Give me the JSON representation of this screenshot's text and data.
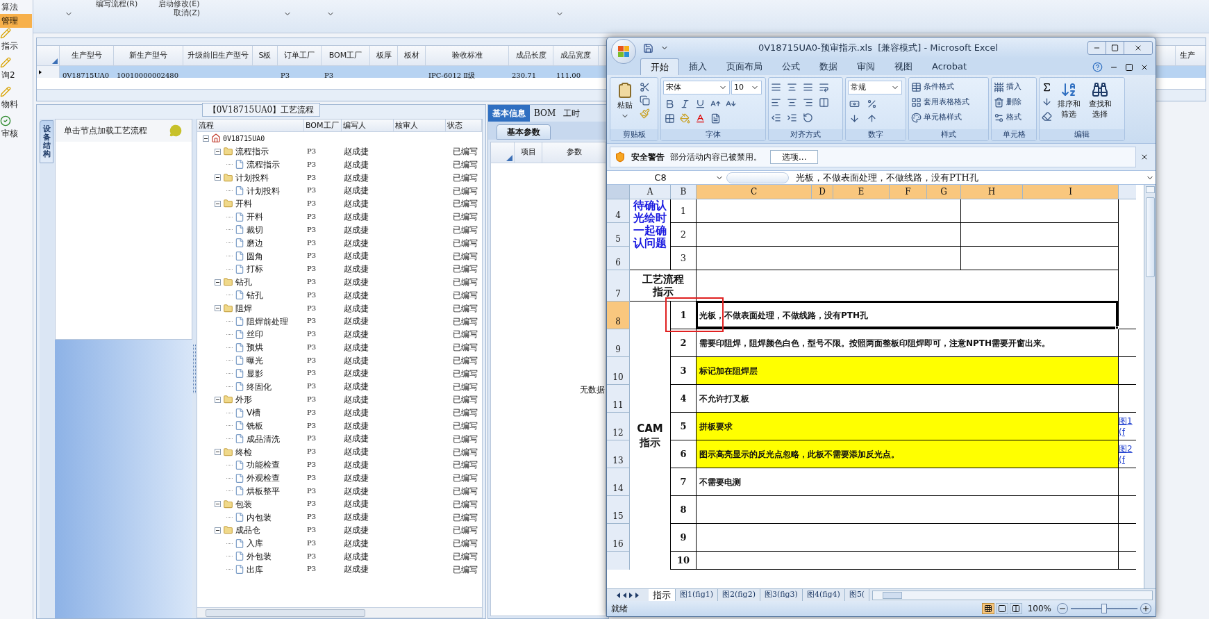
{
  "nav": [
    {
      "label": "算法",
      "selected": false,
      "kind": "text"
    },
    {
      "label": "管理",
      "selected": true,
      "kind": "text"
    },
    {
      "label": "指示",
      "selected": false,
      "kind": "pencil"
    },
    {
      "label": "询2",
      "selected": false,
      "kind": "pencil"
    },
    {
      "label": "物料",
      "selected": false,
      "kind": "pencil"
    },
    {
      "label": "审核",
      "selected": false,
      "kind": "check"
    }
  ],
  "toolbar": {
    "buttons": [
      "编写流程(R)",
      "启动修改(E)",
      "取消(Z)"
    ]
  },
  "main_grid": {
    "columns": [
      "生产型号",
      "新生产型号",
      "升级前旧生产型号",
      "S板",
      "订单工厂",
      "BOM工厂",
      "板厚",
      "板材",
      "验收标准",
      "成品长度",
      "成品宽度",
      "生产"
    ],
    "rows": [
      {
        "selected": true,
        "cells": [
          {
            "kind": "text",
            "text": "0V18715UA0"
          },
          {
            "kind": "text",
            "text": "10010000002480"
          },
          {
            "kind": "blank"
          },
          {
            "kind": "blank"
          },
          {
            "kind": "text",
            "text": "P3"
          },
          {
            "kind": "text",
            "text": "P3"
          },
          {
            "kind": "blank"
          },
          {
            "kind": "blank"
          },
          {
            "kind": "text",
            "text": "IPC-6012 Ⅱ级"
          },
          {
            "kind": "text",
            "text": "230.71"
          },
          {
            "kind": "text",
            "text": "111.00"
          }
        ]
      }
    ]
  },
  "process_panel": {
    "title": "【0V18715UA0】工艺流程",
    "side_tab": "设备结构",
    "hint": "单击节点加载工艺流程",
    "columns": [
      "流程",
      "BOM工厂",
      "编写人",
      "核审人",
      "状态"
    ],
    "tree": {
      "label": "0V18715UA0",
      "expanded": true,
      "children": [
        {
          "label": "流程指示",
          "bom": "P3",
          "writer": "赵成捷",
          "status": "已编写",
          "expanded": true,
          "children": [
            {
              "label": "流程指示",
              "bom": "P3",
              "writer": "赵成捷",
              "status": "已编写"
            }
          ]
        },
        {
          "label": "计划投料",
          "bom": "P3",
          "writer": "赵成捷",
          "status": "已编写",
          "expanded": true,
          "children": [
            {
              "label": "计划投料",
              "bom": "P3",
              "writer": "赵成捷",
              "status": "已编写"
            }
          ]
        },
        {
          "label": "开料",
          "bom": "P3",
          "writer": "赵成捷",
          "status": "已编写",
          "expanded": true,
          "children": [
            {
              "label": "开料",
              "bom": "P3",
              "writer": "赵成捷",
              "status": "已编写"
            },
            {
              "label": "裁切",
              "bom": "P3",
              "writer": "赵成捷",
              "status": "已编写"
            },
            {
              "label": "磨边",
              "bom": "P3",
              "writer": "赵成捷",
              "status": "已编写"
            },
            {
              "label": "圆角",
              "bom": "P3",
              "writer": "赵成捷",
              "status": "已编写"
            },
            {
              "label": "打标",
              "bom": "P3",
              "writer": "赵成捷",
              "status": "已编写"
            }
          ]
        },
        {
          "label": "钻孔",
          "bom": "P3",
          "writer": "赵成捷",
          "status": "已编写",
          "expanded": true,
          "children": [
            {
              "label": "钻孔",
              "bom": "P3",
              "writer": "赵成捷",
              "status": "已编写"
            }
          ]
        },
        {
          "label": "阻焊",
          "bom": "P3",
          "writer": "赵成捷",
          "status": "已编写",
          "expanded": true,
          "children": [
            {
              "label": "阻焊前处理",
              "bom": "P3",
              "writer": "赵成捷",
              "status": "已编写"
            },
            {
              "label": "丝印",
              "bom": "P3",
              "writer": "赵成捷",
              "status": "已编写"
            },
            {
              "label": "预烘",
              "bom": "P3",
              "writer": "赵成捷",
              "status": "已编写"
            },
            {
              "label": "曝光",
              "bom": "P3",
              "writer": "赵成捷",
              "status": "已编写"
            },
            {
              "label": "显影",
              "bom": "P3",
              "writer": "赵成捷",
              "status": "已编写"
            },
            {
              "label": "终固化",
              "bom": "P3",
              "writer": "赵成捷",
              "status": "已编写"
            }
          ]
        },
        {
          "label": "外形",
          "bom": "P3",
          "writer": "赵成捷",
          "status": "已编写",
          "expanded": true,
          "children": [
            {
              "label": "V槽",
              "bom": "P3",
              "writer": "赵成捷",
              "status": "已编写"
            },
            {
              "label": "铣板",
              "bom": "P3",
              "writer": "赵成捷",
              "status": "已编写"
            },
            {
              "label": "成品清洗",
              "bom": "P3",
              "writer": "赵成捷",
              "status": "已编写"
            }
          ]
        },
        {
          "label": "终检",
          "bom": "P3",
          "writer": "赵成捷",
          "status": "已编写",
          "expanded": true,
          "children": [
            {
              "label": "功能检查",
              "bom": "P3",
              "writer": "赵成捷",
              "status": "已编写"
            },
            {
              "label": "外观检查",
              "bom": "P3",
              "writer": "赵成捷",
              "status": "已编写"
            },
            {
              "label": "烘板整平",
              "bom": "P3",
              "writer": "赵成捷",
              "status": "已编写"
            }
          ]
        },
        {
          "label": "包装",
          "bom": "P3",
          "writer": "赵成捷",
          "status": "已编写",
          "expanded": true,
          "children": [
            {
              "label": "内包装",
              "bom": "P3",
              "writer": "赵成捷",
              "status": "已编写"
            }
          ]
        },
        {
          "label": "成品仓",
          "bom": "P3",
          "writer": "赵成捷",
          "status": "已编写",
          "expanded": true,
          "children": [
            {
              "label": "入库",
              "bom": "P3",
              "writer": "赵成捷",
              "status": "已编写"
            },
            {
              "label": "外包装",
              "bom": "P3",
              "writer": "赵成捷",
              "status": "已编写"
            },
            {
              "label": "出库",
              "bom": "P3",
              "writer": "赵成捷",
              "status": "已编写"
            }
          ]
        }
      ]
    }
  },
  "info_panel": {
    "tabs": [
      {
        "label": "基本信息",
        "selected": true
      },
      {
        "label": "BOM",
        "selected": false
      },
      {
        "label": "工时",
        "selected": false
      }
    ],
    "sub_tab": "基本参数",
    "columns": [
      "项目",
      "参数"
    ],
    "empty_text": "无数据"
  },
  "excel": {
    "title": "0V18715UA0-预审指示.xls  [兼容模式] - Microsoft Excel",
    "ribbon_tabs": [
      {
        "label": "开始",
        "selected": true
      },
      {
        "label": "插入",
        "selected": false
      },
      {
        "label": "页面布局",
        "selected": false
      },
      {
        "label": "公式",
        "selected": false
      },
      {
        "label": "数据",
        "selected": false
      },
      {
        "label": "审阅",
        "selected": false
      },
      {
        "label": "视图",
        "selected": false
      },
      {
        "label": "Acrobat",
        "selected": false
      }
    ],
    "groups": [
      "剪贴板",
      "字体",
      "对齐方式",
      "数字",
      "样式",
      "单元格",
      "编辑"
    ],
    "paste": "粘贴",
    "font_name": "宋体",
    "font_size": "10",
    "number_format": "常规",
    "styles": [
      "条件格式",
      "套用表格格式",
      "单元格样式"
    ],
    "cells": [
      "插入",
      "删除",
      "格式"
    ],
    "editing": [
      "排序和筛选",
      "查找和选择"
    ],
    "security": {
      "title": "安全警告",
      "message": "部分活动内容已被禁用。",
      "button": "选项..."
    },
    "name_box": "C8",
    "formula": "光板，不做表面处理，不做线路，没有PTH孔",
    "columns": [
      {
        "label": "A",
        "selected": false
      },
      {
        "label": "B",
        "selected": false
      },
      {
        "label": "C",
        "selected": true
      },
      {
        "label": "D",
        "selected": true
      },
      {
        "label": "E",
        "selected": true
      },
      {
        "label": "F",
        "selected": true
      },
      {
        "label": "G",
        "selected": true
      },
      {
        "label": "H",
        "selected": true
      },
      {
        "label": "I",
        "selected": true
      }
    ],
    "rows": [
      {
        "label": "4",
        "selected": false
      },
      {
        "label": "5",
        "selected": false
      },
      {
        "label": "6",
        "selected": false
      },
      {
        "label": "7",
        "selected": false
      },
      {
        "label": "8",
        "selected": true
      },
      {
        "label": "9",
        "selected": false
      },
      {
        "label": "10",
        "selected": false
      },
      {
        "label": "11",
        "selected": false
      },
      {
        "label": "12",
        "selected": false
      },
      {
        "label": "13",
        "selected": false
      },
      {
        "label": "14",
        "selected": false
      },
      {
        "label": "15",
        "selected": false
      },
      {
        "label": "16",
        "selected": false
      }
    ],
    "confirm": {
      "label": "待确认光绘时一起确认问题",
      "items": [
        "1",
        "2",
        "3"
      ]
    },
    "process_label": "工艺流程指示",
    "cam": {
      "label": "CAM指示",
      "items": [
        {
          "no": "1",
          "text": "光板，不做表面处理，不做线路，没有PTH孔",
          "highlighted": false
        },
        {
          "no": "2",
          "text": "需要印阻焊，阻焊颜色白色，型号不限。按照两面整板印阻焊即可，注意NPTH需要开窗出来。",
          "highlighted": false
        },
        {
          "no": "3",
          "text": "标记加在阻焊层",
          "highlighted": true
        },
        {
          "no": "4",
          "text": "不允许打叉板",
          "highlighted": false
        },
        {
          "no": "5",
          "text": "拼板要求",
          "highlighted": true,
          "link": "图1(f"
        },
        {
          "no": "6",
          "text": "图示高亮显示的反光点忽略，此板不需要添加反光点。",
          "highlighted": true,
          "link": "图2(f"
        },
        {
          "no": "7",
          "text": "不需要电测",
          "highlighted": false
        },
        {
          "no": "8",
          "highlighted": false
        },
        {
          "no": "9",
          "highlighted": false
        },
        {
          "no": "10",
          "highlighted": false
        }
      ]
    },
    "sheet_tabs": [
      {
        "label": "指示",
        "selected": true
      },
      {
        "label": "图1(fig1)",
        "selected": false
      },
      {
        "label": "图2(fig2)",
        "selected": false
      },
      {
        "label": "图3(fig3)",
        "selected": false
      },
      {
        "label": "图4(fig4)",
        "selected": false
      },
      {
        "label": "图5(",
        "selected": false
      }
    ],
    "status": "就绪",
    "zoom": "100%",
    "zoom_slider": {
      "level": 0.5
    }
  }
}
